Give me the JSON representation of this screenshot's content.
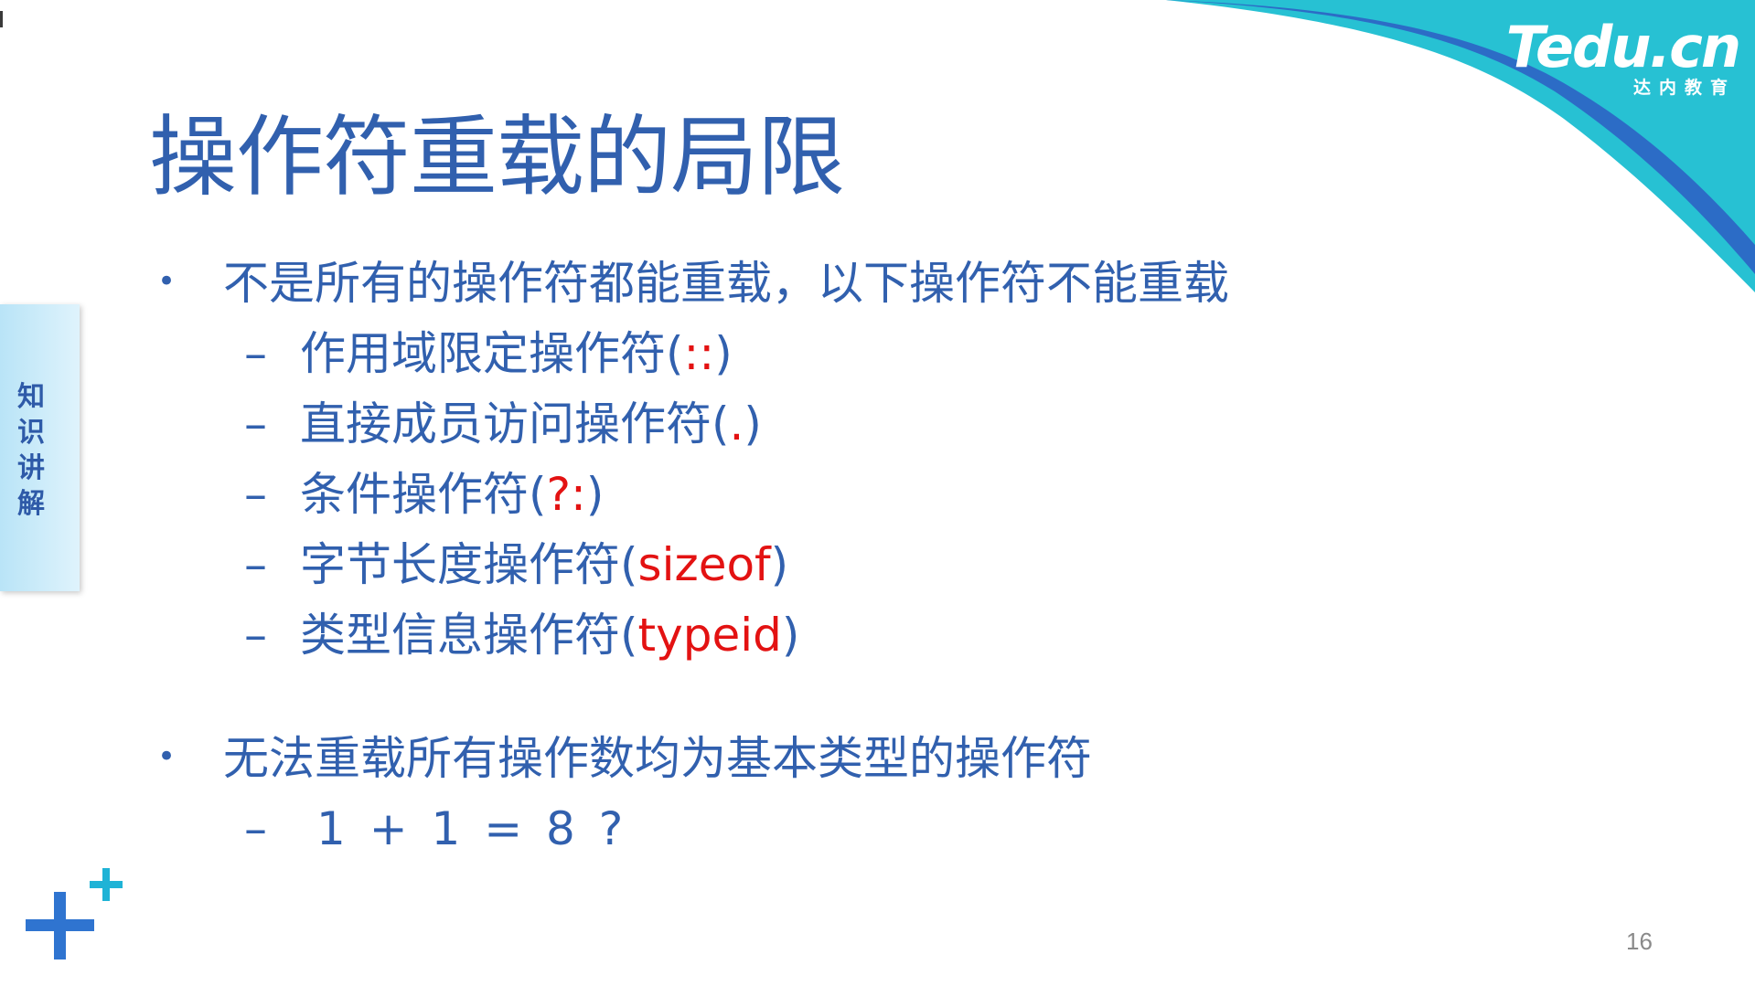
{
  "brand": {
    "logo_text": "Tedu.cn",
    "logo_subtitle": "达内教育",
    "colors": {
      "title_blue": "#3160ae",
      "highlight_red": "#e31212",
      "accent_teal": "#27c1d3",
      "accent_blue": "#2c6cc6"
    }
  },
  "side_tab": {
    "label": "知识讲解"
  },
  "slide": {
    "title": "操作符重载的局限",
    "bullets": [
      {
        "text": "不是所有的操作符都能重载，以下操作符不能重载",
        "subitems": [
          {
            "text": "作用域限定操作符(",
            "highlight": "::",
            "close": ")"
          },
          {
            "text": "直接成员访问操作符(",
            "highlight": ".",
            "close": ")"
          },
          {
            "text": "条件操作符(",
            "highlight": "?:",
            "close": ")"
          },
          {
            "text": "字节长度操作符(",
            "highlight": "sizeof",
            "close": ")"
          },
          {
            "text": "类型信息操作符(",
            "highlight": "typeid",
            "close": ")"
          }
        ]
      },
      {
        "text": "无法重载所有操作数均为基本类型的操作符",
        "subitems": [
          {
            "text": "1 + 1 = 8 ?"
          }
        ]
      }
    ],
    "bullet_symbol": "•",
    "dash_symbol": "–"
  },
  "page_number": "16"
}
